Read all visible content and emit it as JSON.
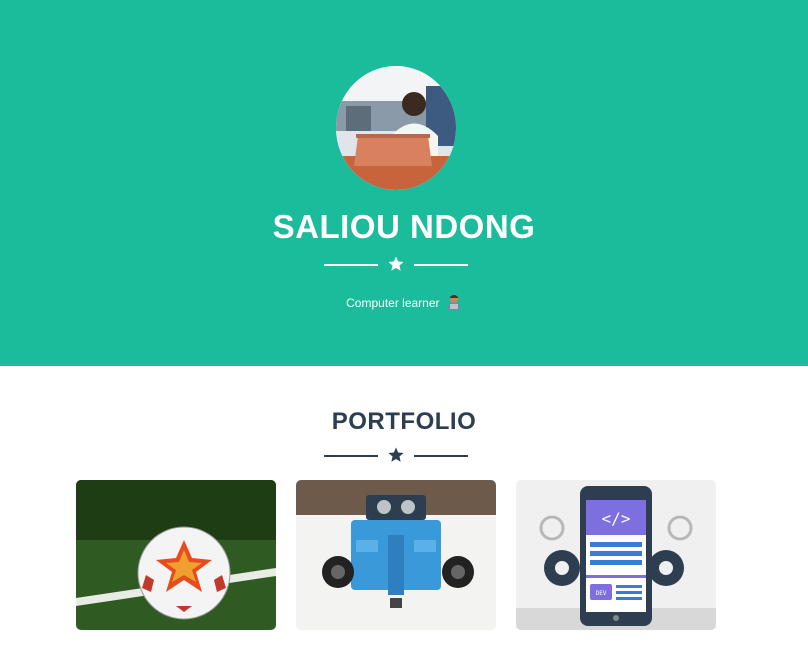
{
  "profile": {
    "name": "SALIOU NDONG",
    "subtitle": "Computer learner"
  },
  "portfolio": {
    "title": "PORTFOLIO",
    "items": [
      {
        "image": "soccer-ball-on-grass"
      },
      {
        "image": "robot-kit"
      },
      {
        "image": "smartphone-dev-illustration"
      }
    ]
  },
  "colors": {
    "primary": "#1abc9c",
    "secondary": "#2c3e50",
    "white": "#ffffff"
  },
  "icons": {
    "divider": "star-icon",
    "subtitle": "technologist-emoji-icon"
  }
}
